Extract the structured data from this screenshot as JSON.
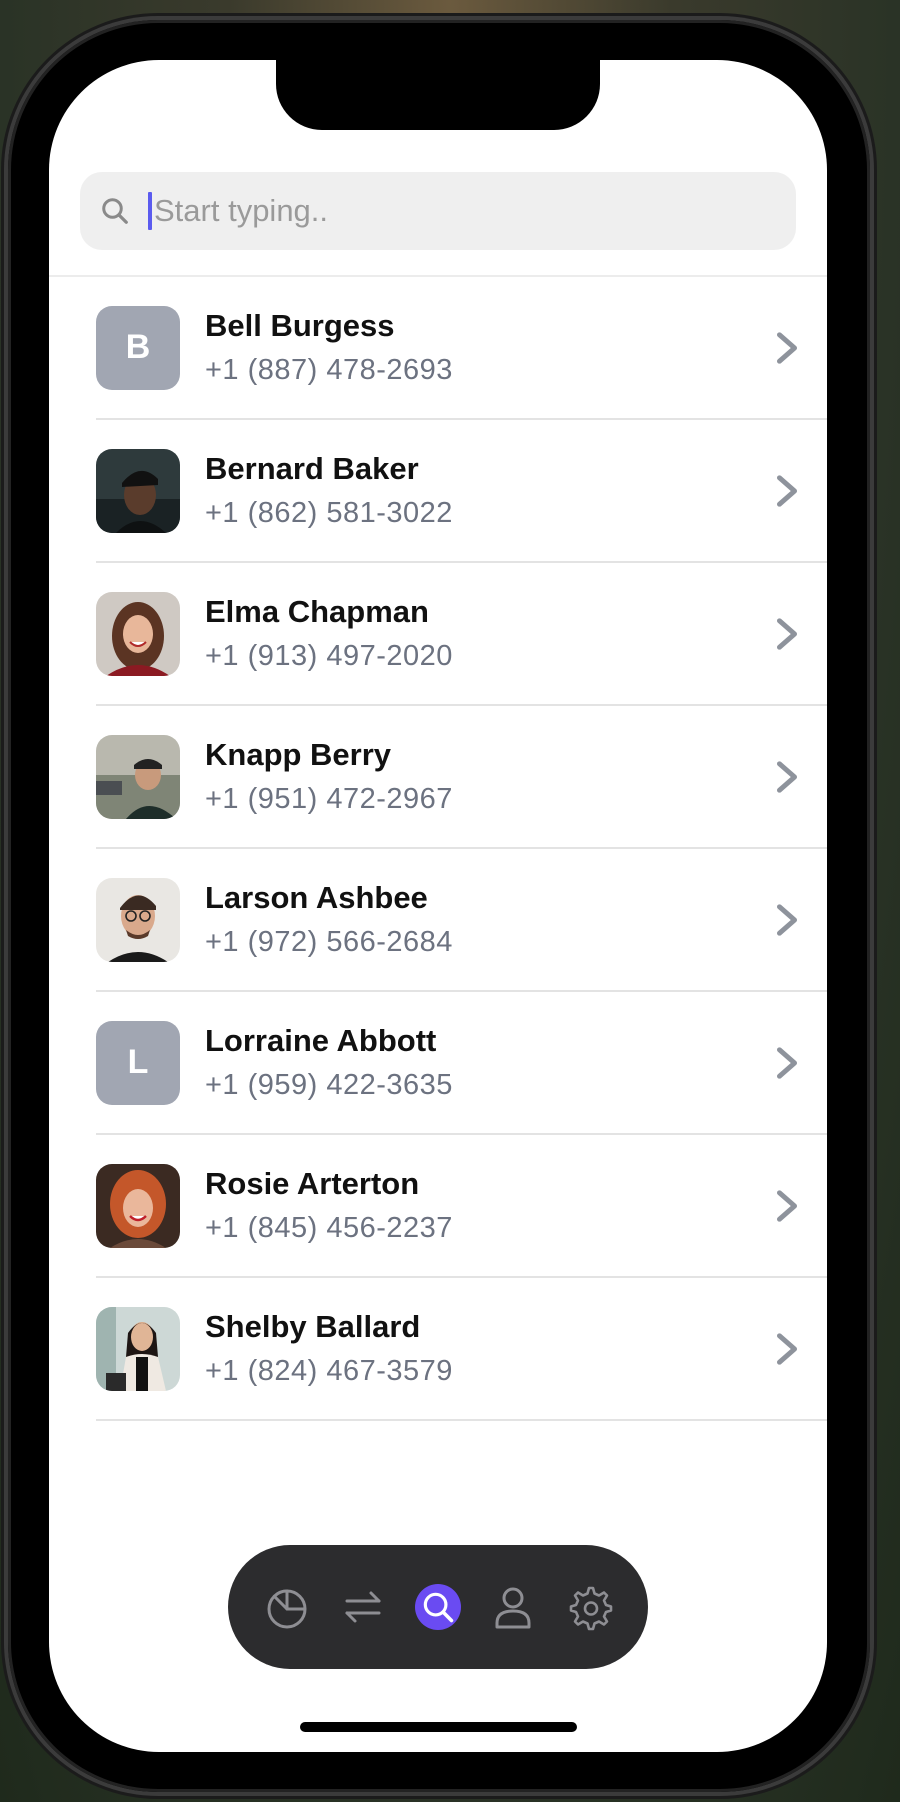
{
  "search": {
    "placeholder": "Start typing.."
  },
  "contacts": [
    {
      "name": "Bell Burgess",
      "phone": "+1 (887) 478-2693",
      "avatar_initial": "B"
    },
    {
      "name": "Bernard Baker",
      "phone": "+1 (862) 581-3022"
    },
    {
      "name": "Elma Chapman",
      "phone": "+1 (913) 497-2020"
    },
    {
      "name": "Knapp Berry",
      "phone": "+1 (951) 472-2967"
    },
    {
      "name": "Larson Ashbee",
      "phone": "+1 (972) 566-2684"
    },
    {
      "name": "Lorraine Abbott",
      "phone": "+1 (959) 422-3635",
      "avatar_initial": "L"
    },
    {
      "name": "Rosie Arterton",
      "phone": "+1 (845) 456-2237"
    },
    {
      "name": "Shelby Ballard",
      "phone": "+1 (824) 467-3579"
    }
  ],
  "tab_bar": {
    "items": [
      {
        "icon": "pie-chart-icon",
        "active": false
      },
      {
        "icon": "transfer-arrows-icon",
        "active": false
      },
      {
        "icon": "search-icon",
        "active": true
      },
      {
        "icon": "user-icon",
        "active": false
      },
      {
        "icon": "gear-icon",
        "active": false
      }
    ]
  },
  "colors": {
    "accent": "#6a4bf2",
    "tab_bar_bg": "#2c2c2e",
    "initial_avatar_bg": "#a1a6b2",
    "phone_text": "#6c7280"
  }
}
